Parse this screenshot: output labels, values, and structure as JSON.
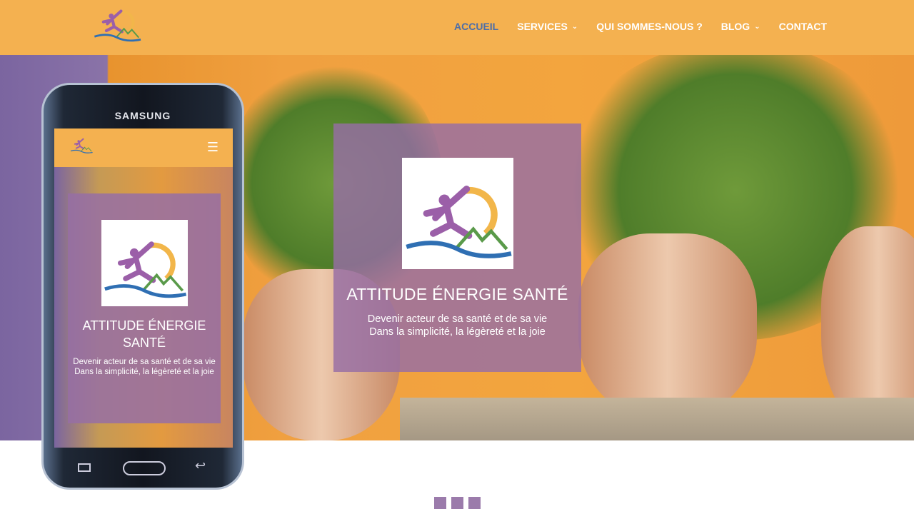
{
  "nav": {
    "items": [
      {
        "label": "ACCUEIL",
        "active": true
      },
      {
        "label": "SERVICES",
        "dropdown": true
      },
      {
        "label": "QUI SOMMES-NOUS ?"
      },
      {
        "label": "BLOG",
        "dropdown": true
      },
      {
        "label": "CONTACT"
      }
    ]
  },
  "hero": {
    "title": "ATTITUDE ÉNERGIE SANTÉ",
    "line1": "Devenir acteur de sa santé et de sa vie",
    "line2": "Dans la simplicité, la légèreté et la joie"
  },
  "phone": {
    "brand": "SAMSUNG",
    "title": "ATTITUDE ÉNERGIE SANTÉ",
    "line1": "Devenir acteur de sa santé et de sa vie",
    "line2": "Dans la simplicité, la légèreté et la joie"
  },
  "colors": {
    "header": "#f4b150",
    "accent": "#4d6ea8",
    "purple": "#9b7bab"
  }
}
